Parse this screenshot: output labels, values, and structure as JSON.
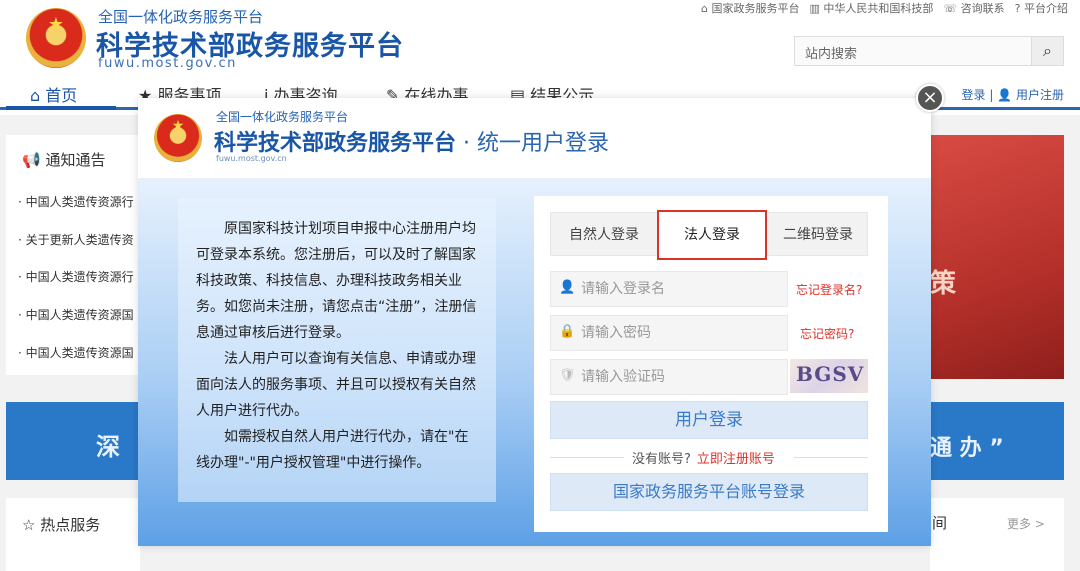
{
  "background": {
    "header": {
      "subtitle": "全国一体化政务服务平台",
      "title": "科学技术部政务服务平台",
      "domain": "fuwu.most.gov.cn"
    },
    "top_links": [
      "国家政务服务平台",
      "中华人民共和国科技部",
      "咨询联系",
      "平台介绍"
    ],
    "search": {
      "placeholder": "站内搜索"
    },
    "nav": [
      "首页",
      "服务事项",
      "办事咨询",
      "在线办事",
      "结果公示"
    ],
    "nav_right": {
      "login": "登录",
      "register": "用户注册"
    },
    "notice": {
      "title": "通知通告",
      "items": [
        "中国人类遗传资源行",
        "关于更新人类遗传资",
        "中国人类遗传资源行",
        "中国人类遗传资源国",
        "中国人类遗传资源国"
      ]
    },
    "band_left": "深",
    "band_right": "通 办 ”",
    "photo_text": "策",
    "hot_title": "热点服务",
    "more_link": "更多 >",
    "right_card_char": "间"
  },
  "modal": {
    "subtitle": "全国一体化政务服务平台",
    "title": "科学技术部政务服务平台",
    "title_sep": " · ",
    "title_suffix": "统一用户登录",
    "domain": "fuwu.most.gov.cn",
    "info_paragraphs": [
      "原国家科技计划项目申报中心注册用户均可登录本系统。您注册后，可以及时了解国家科技政策、科技信息、办理科技政务相关业务。如您尚未注册，请您点击“注册”，注册信息通过审核后进行登录。",
      "法人用户可以查询有关信息、申请或办理面向法人的服务事项、并且可以授权有关自然人用户进行代办。",
      "如需授权自然人用户进行代办，请在\"在线办理\"-\"用户授权管理\"中进行操作。"
    ],
    "tabs": [
      "自然人登录",
      "法人登录",
      "二维码登录"
    ],
    "active_tab": "法人登录",
    "fields": {
      "username_placeholder": "请输入登录名",
      "password_placeholder": "请输入密码",
      "captcha_placeholder": "请输入验证码"
    },
    "forgot_username": "忘记登录名?",
    "forgot_password": "忘记密码?",
    "captcha_text": "BGSV",
    "login_button": "用户登录",
    "no_account": "没有账号?",
    "register_link": "立即注册账号",
    "gov_login_button": "国家政务服务平台账号登录",
    "close_icon": "close-icon"
  },
  "colors": {
    "brand_blue": "#1a56a6",
    "accent_red": "#d9332b",
    "button_bg": "#dde9f7"
  }
}
